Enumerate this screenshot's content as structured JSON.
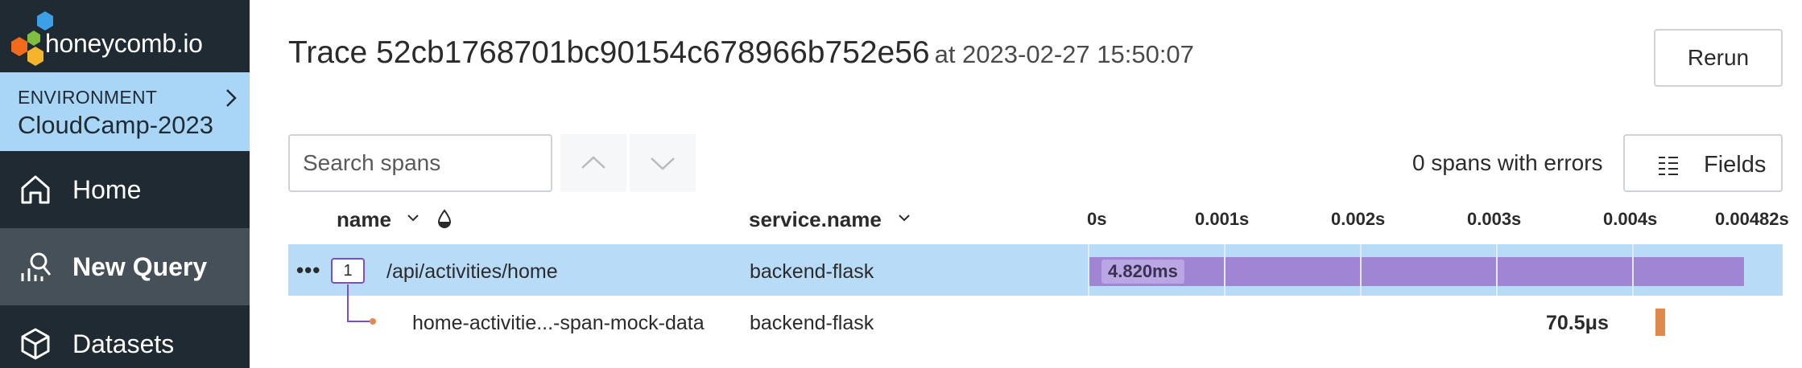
{
  "app": {
    "logo_text": "honeycomb.io"
  },
  "sidebar": {
    "environment_label": "ENVIRONMENT",
    "environment_name": "CloudCamp-2023",
    "items": [
      {
        "label": "Home",
        "icon": "home-icon"
      },
      {
        "label": "New Query",
        "icon": "query-icon",
        "active": true
      },
      {
        "label": "Datasets",
        "icon": "cube-icon"
      }
    ]
  },
  "header": {
    "title": "Trace 52cb1768701bc90154c678966b752e56",
    "timestamp": "at 2023-02-27 15:50:07",
    "rerun_label": "Rerun"
  },
  "toolbar": {
    "search_placeholder": "Search spans",
    "errors_text": "0 spans with errors",
    "fields_label": "Fields"
  },
  "table": {
    "columns": [
      "name",
      "service.name"
    ],
    "ticks": [
      "0s",
      "0.001s",
      "0.002s",
      "0.003s",
      "0.004s",
      "0.00482s"
    ],
    "rows": [
      {
        "count": "1",
        "name": "/api/activities/home",
        "service": "backend-flask",
        "duration_label": "4.820ms",
        "duration_ms": 4.82,
        "start_ms": 0,
        "selected": true
      },
      {
        "name": "home-activitie...-span-mock-data",
        "service": "backend-flask",
        "duration_label": "70.5μs",
        "duration_ms": 0.0705
      }
    ]
  },
  "colors": {
    "sidebar_bg": "#1f2a33",
    "env_bg": "#a9d6f7",
    "selected_row": "#b8dcf7",
    "span_bar": "#9f85d4",
    "child_span": "#e0894f",
    "accent": "#7b4fc9"
  }
}
